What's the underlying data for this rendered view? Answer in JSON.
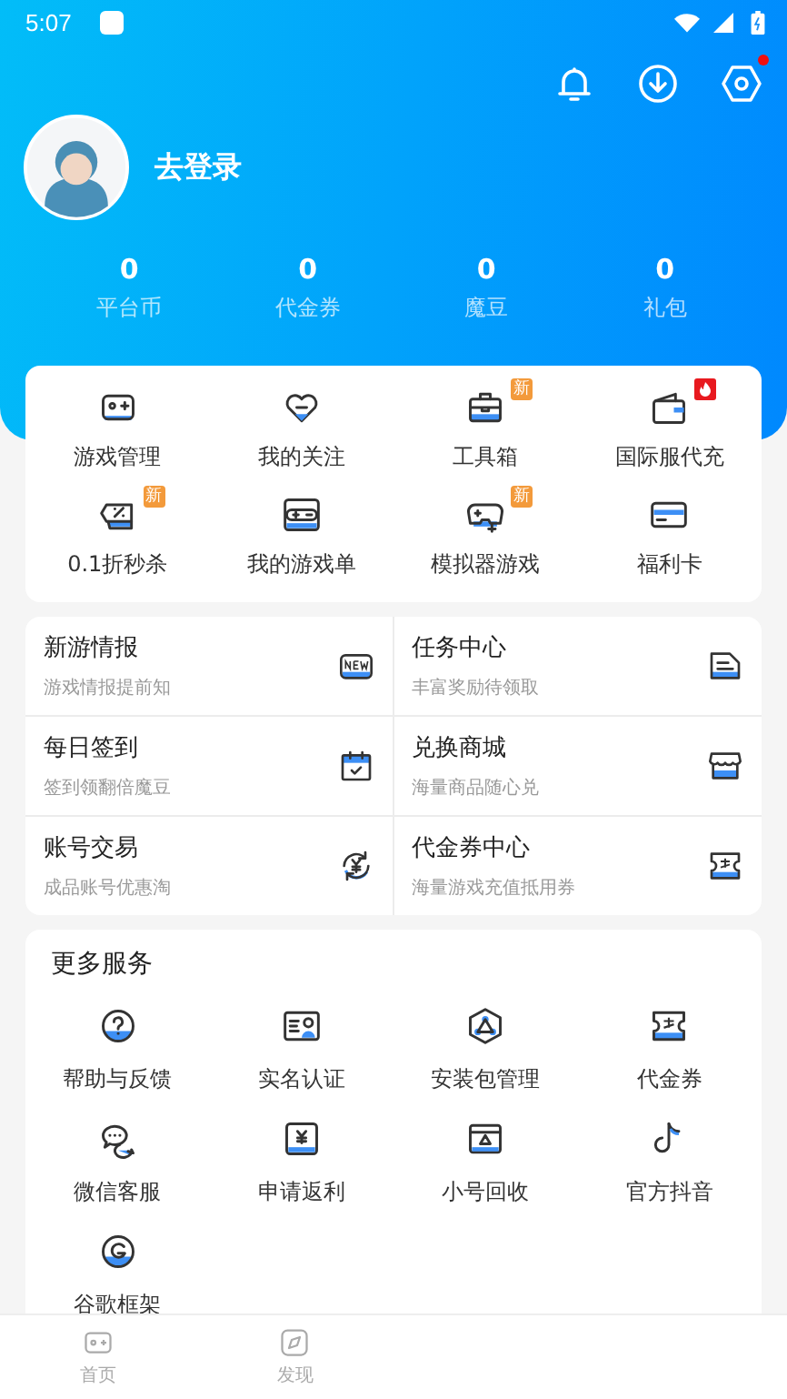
{
  "status_bar": {
    "time": "5:07"
  },
  "header": {
    "settings_notification": true,
    "login_label": "去登录",
    "stats": [
      {
        "value": "0",
        "label": "平台币"
      },
      {
        "value": "0",
        "label": "代金券"
      },
      {
        "value": "0",
        "label": "魔豆"
      },
      {
        "value": "0",
        "label": "礼包"
      }
    ]
  },
  "quick_menu": [
    {
      "label": "游戏管理"
    },
    {
      "label": "我的关注"
    },
    {
      "label": "工具箱",
      "badge": {
        "kind": "new",
        "text": "新"
      }
    },
    {
      "label": "国际服代充",
      "badge": {
        "kind": "hot"
      }
    },
    {
      "label": "0.1折秒杀",
      "badge": {
        "kind": "new",
        "text": "新"
      }
    },
    {
      "label": "我的游戏单"
    },
    {
      "label": "模拟器游戏",
      "badge": {
        "kind": "new",
        "text": "新"
      }
    },
    {
      "label": "福利卡"
    }
  ],
  "feature_tiles": [
    {
      "title": "新游情报",
      "subtitle": "游戏情报提前知"
    },
    {
      "title": "任务中心",
      "subtitle": "丰富奖励待领取"
    },
    {
      "title": "每日签到",
      "subtitle": "签到领翻倍魔豆"
    },
    {
      "title": "兑换商城",
      "subtitle": "海量商品随心兑"
    },
    {
      "title": "账号交易",
      "subtitle": "成品账号优惠淘"
    },
    {
      "title": "代金券中心",
      "subtitle": "海量游戏充值抵用券"
    }
  ],
  "more_services": {
    "title": "更多服务",
    "items": [
      {
        "label": "帮助与反馈"
      },
      {
        "label": "实名认证"
      },
      {
        "label": "安装包管理"
      },
      {
        "label": "代金券"
      },
      {
        "label": "微信客服"
      },
      {
        "label": "申请返利"
      },
      {
        "label": "小号回收"
      },
      {
        "label": "官方抖音"
      },
      {
        "label": "谷歌框架"
      }
    ]
  },
  "bottom_nav": [
    {
      "label": "首页"
    },
    {
      "label": "发现"
    }
  ]
}
